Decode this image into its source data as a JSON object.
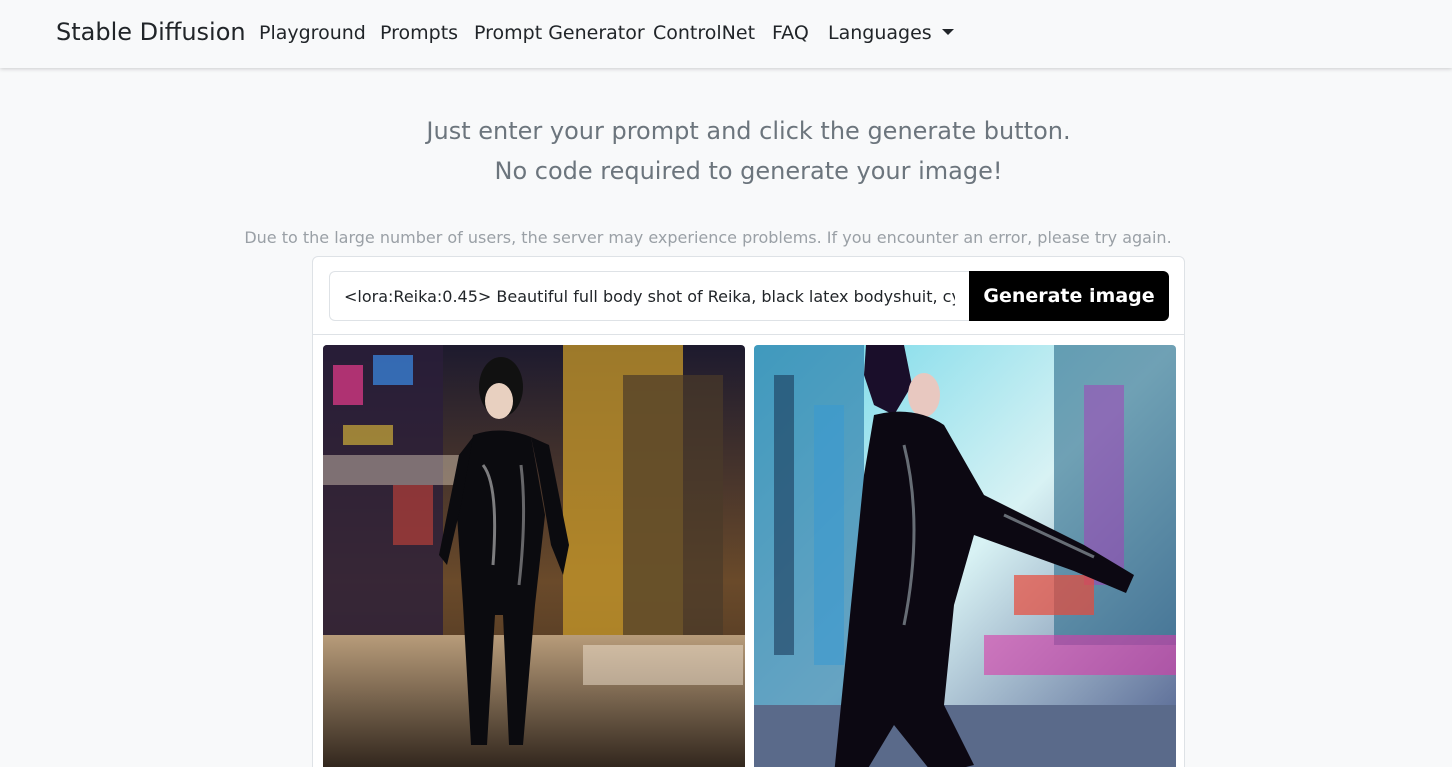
{
  "navbar": {
    "brand": "Stable Diffusion",
    "items": [
      {
        "label": "Playground"
      },
      {
        "label": "Prompts"
      },
      {
        "label": "Prompt Generator"
      },
      {
        "label": "ControlNet"
      },
      {
        "label": "FAQ"
      },
      {
        "label": "Languages",
        "icon": "caret-down-icon"
      }
    ]
  },
  "hero": {
    "subtitle_line1": "Just enter your prompt and click the generate button.",
    "subtitle_line2": "No code required to generate your image!"
  },
  "notice": "Due to the large number of users, the server may experience problems. If you encounter an error, please try again.",
  "generator": {
    "prompt_value": "<lora:Reika:0.45> Beautiful full body shot of Reika, black latex bodyshuit, cyberpunk city background",
    "button_label": "Generate image"
  },
  "results": [
    {
      "subject": "generated-image-1"
    },
    {
      "subject": "generated-image-2"
    }
  ],
  "colors": {
    "navbar_bg": "#f8f9fa",
    "button_bg": "#000000",
    "muted_text": "#6c757d"
  }
}
